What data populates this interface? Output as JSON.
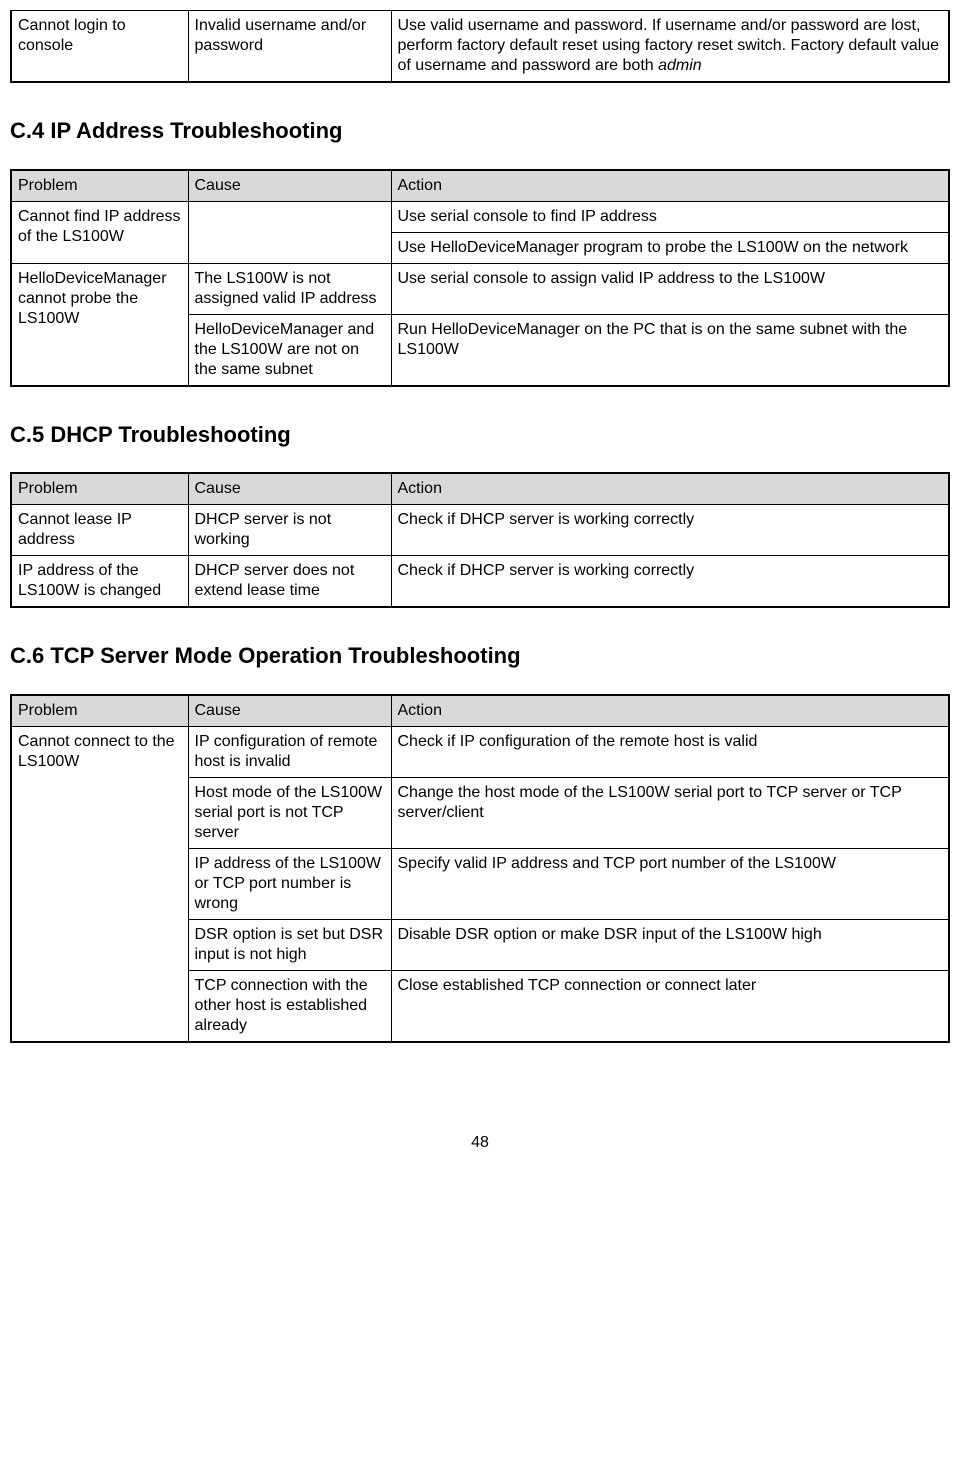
{
  "fragment": {
    "problem": "Cannot login to console",
    "cause": "Invalid username and/or password",
    "action_prefix": "Use valid username and password. If username and/or password are lost, perform factory default reset using factory reset switch. Factory default value of username and password are both ",
    "action_italic": "admin"
  },
  "headers": {
    "problem": "Problem",
    "cause": "Cause",
    "action": "Action"
  },
  "c4": {
    "title": "C.4 IP Address Troubleshooting",
    "row1_problem": "Cannot find IP address of the LS100W",
    "row1_cause": "",
    "row1_action_a": "Use serial console to find IP address",
    "row1_action_b": "Use HelloDeviceManager program to probe the LS100W on the network",
    "row2_problem": "HelloDeviceManager cannot probe the LS100W",
    "row2_cause_a": "The LS100W is not assigned valid IP address",
    "row2_action_a": "Use serial console to assign valid IP address to the LS100W",
    "row2_cause_b": "HelloDeviceManager and the LS100W are not on the same subnet",
    "row2_action_b": "Run HelloDeviceManager on the PC that is on the same subnet with the LS100W"
  },
  "c5": {
    "title": "C.5 DHCP Troubleshooting",
    "row1_problem": "Cannot lease IP address",
    "row1_cause": "DHCP server is not working",
    "row1_action": "Check if DHCP server is working correctly",
    "row2_problem": "IP address of the LS100W is changed",
    "row2_cause": "DHCP server does not extend lease time",
    "row2_action": "Check if DHCP server is working correctly"
  },
  "c6": {
    "title": "C.6 TCP Server Mode Operation Troubleshooting",
    "row_problem": "Cannot connect to the LS100W",
    "r1_cause": "IP configuration of remote host is invalid",
    "r1_action": "Check if IP configuration of the remote host is valid",
    "r2_cause": "Host mode of the LS100W serial port is not TCP server",
    "r2_action": "Change the host mode of the LS100W serial port to TCP server or TCP server/client",
    "r3_cause": "IP address of the LS100W or TCP port number is wrong",
    "r3_action": "Specify valid IP address and TCP port number of the LS100W",
    "r4_cause": "DSR option is set but DSR input is not high",
    "r4_action": "Disable DSR option or make DSR input of the LS100W high",
    "r5_cause": "TCP connection with the other host is established already",
    "r5_action": "Close established TCP connection or connect later"
  },
  "page_number": "48"
}
